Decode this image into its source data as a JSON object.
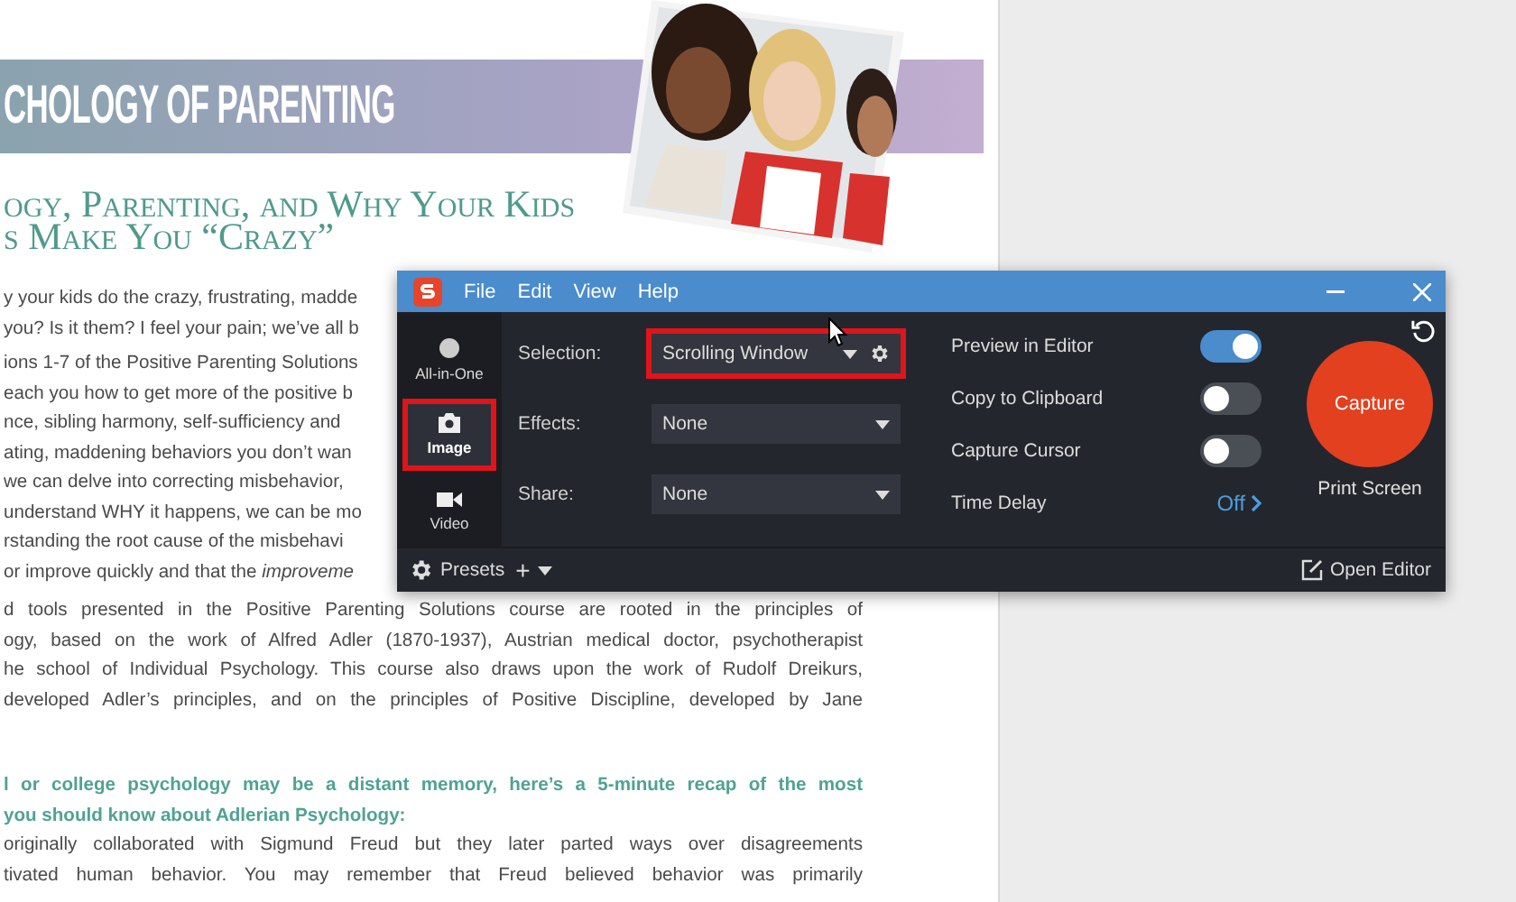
{
  "document": {
    "banner_title": "CHOLOGY OF PARENTING",
    "subtitle_lines": [
      "ogy, Parenting, and Why Your Kids",
      "s Make You “Crazy”"
    ],
    "paragraphs": [
      {
        "kind": "cut",
        "lines": [
          "y your kids do the crazy, frustrating, madde",
          "you? Is it them? I feel your pain; we’ve all b"
        ]
      },
      {
        "kind": "cut",
        "lines": [
          "ions 1-7 of the Positive Parenting Solutions",
          "each you how to get more of the positive b",
          "nce, sibling harmony, self-sufficiency and",
          "ating, maddening behaviors you don’t wan",
          "we can delve into correcting misbehavior,",
          "understand WHY it happens, we can be mo",
          "rstanding the root cause of the misbehavi",
          "or improve quickly and that the *improveme*"
        ]
      },
      {
        "kind": "body",
        "lines": [
          "d tools presented in the Positive Parenting Solutions course are rooted in the principles of",
          "ogy, based on the work of Alfred Adler (1870-1937), Austrian medical doctor, psychotherapist",
          "he school of Individual Psychology. This course also draws upon the work of Rudolf Dreikurs,",
          "developed Adler’s principles, and on the principles of Positive Discipline, developed by Jane"
        ]
      },
      {
        "kind": "highlight",
        "lines": [
          "l or college psychology may be a distant memory, here’s a 5-minute recap of the most",
          "you should know about Adlerian Psychology:"
        ]
      },
      {
        "kind": "body",
        "lines": [
          "originally collaborated with Sigmund Freud but they later parted ways over disagreements",
          "tivated human behavior. You may remember that Freud believed behavior was primarily"
        ]
      }
    ]
  },
  "capture_window": {
    "menu": [
      "File",
      "Edit",
      "View",
      "Help"
    ],
    "modes": [
      {
        "label": "All-in-One",
        "kind": "all",
        "selected": false,
        "highlighted": false
      },
      {
        "label": "Image",
        "selected": true,
        "highlighted": true
      },
      {
        "label": "Video",
        "kind": "video",
        "selected": false,
        "highlighted": false
      }
    ],
    "settings": [
      {
        "label": "Selection:",
        "value": "Scrolling Window",
        "highlighted": true,
        "has_gear": true
      },
      {
        "label": "Effects:",
        "value": "None",
        "highlighted": false,
        "has_gear": false
      },
      {
        "label": "Share:",
        "value": "None",
        "highlighted": false,
        "has_gear": false
      }
    ],
    "options": [
      {
        "label": "Preview in Editor",
        "on": true
      },
      {
        "label": "Copy to Clipboard",
        "on": false
      },
      {
        "label": "Capture Cursor",
        "on": false
      }
    ],
    "time_delay": {
      "label": "Time Delay",
      "value": "Off"
    },
    "capture_button": "Capture",
    "shortcut": "Print Screen",
    "presets_label": "Presets",
    "add_preset": "+",
    "open_editor": "Open Editor"
  }
}
